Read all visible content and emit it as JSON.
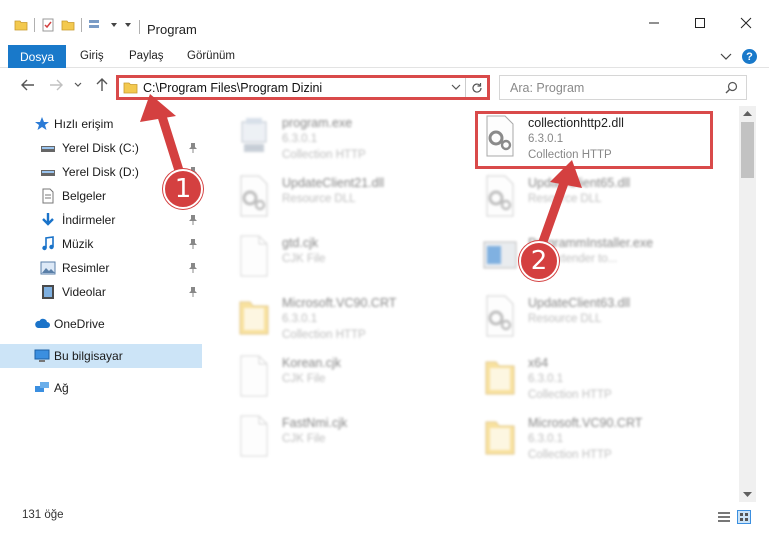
{
  "window": {
    "title": "Program",
    "minimize": "—",
    "maximize": "☐",
    "close": "✕"
  },
  "ribbon": {
    "file": "Dosya",
    "home": "Giriş",
    "share": "Paylaş",
    "view": "Görünüm",
    "help": "?"
  },
  "address": {
    "path": "C:\\Program Files\\Program Dizini",
    "search_placeholder": "Ara: Program"
  },
  "sidebar": {
    "quick_access": "Hızlı erişim",
    "items": [
      {
        "label": "Yerel Disk (C:)",
        "icon": "drive-icon",
        "pinned": true
      },
      {
        "label": "Yerel Disk (D:)",
        "icon": "drive-icon",
        "pinned": true
      },
      {
        "label": "Belgeler",
        "icon": "documents-icon",
        "pinned": true
      },
      {
        "label": "İndirmeler",
        "icon": "downloads-icon",
        "pinned": true
      },
      {
        "label": "Müzik",
        "icon": "music-icon",
        "pinned": true
      },
      {
        "label": "Resimler",
        "icon": "pictures-icon",
        "pinned": true
      },
      {
        "label": "Videolar",
        "icon": "videos-icon",
        "pinned": true
      }
    ],
    "onedrive": "OneDrive",
    "this_pc": "Bu bilgisayar",
    "network": "Ağ"
  },
  "files": [
    {
      "name": "program.exe",
      "line2": "6.3.0.1",
      "line3": "Collection HTTP",
      "type": "exe",
      "blurred": true
    },
    {
      "name": "collectionhttp2.dll",
      "line2": "6.3.0.1",
      "line3": "Collection HTTP",
      "type": "dll",
      "blurred": false
    },
    {
      "name": "UpdateClient21.dll",
      "line2": "Resource DLL",
      "line3": "",
      "type": "dll",
      "blurred": true
    },
    {
      "name": "UpdateClient65.dll",
      "line2": "Resource DLL",
      "line3": "",
      "type": "dll",
      "blurred": true
    },
    {
      "name": "gtd.cjk",
      "line2": "CJK File",
      "line3": "",
      "type": "file",
      "blurred": true
    },
    {
      "name": "ProgrammInstaller.exe",
      "line2": "ZIP Extender to...",
      "line3": "",
      "type": "installer",
      "blurred": true
    },
    {
      "name": "Microsoft.VC90.CRT",
      "line2": "6.3.0.1",
      "line3": "Collection HTTP",
      "type": "folder",
      "blurred": true
    },
    {
      "name": "UpdateClient63.dll",
      "line2": "Resource DLL",
      "line3": "",
      "type": "dll",
      "blurred": true
    },
    {
      "name": "Korean.cjk",
      "line2": "CJK File",
      "line3": "",
      "type": "file",
      "blurred": true
    },
    {
      "name": "x64",
      "line2": "6.3.0.1",
      "line3": "Collection HTTP",
      "type": "folder",
      "blurred": true
    },
    {
      "name": "FastNmi.cjk",
      "line2": "CJK File",
      "line3": "",
      "type": "file",
      "blurred": true
    },
    {
      "name": "Microsoft.VC90.CRT",
      "line2": "6.3.0.1",
      "line3": "Collection HTTP",
      "type": "folder",
      "blurred": true
    }
  ],
  "status": {
    "count": "131 öğe"
  },
  "callouts": [
    "1",
    "2"
  ],
  "colors": {
    "accent": "#1979ca",
    "callout": "#d44040",
    "selection": "#cce4f7"
  }
}
